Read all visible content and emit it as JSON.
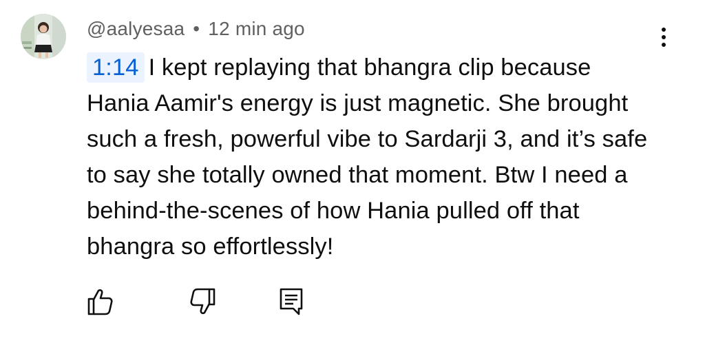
{
  "comment": {
    "author": "@aalyesaa",
    "separator": "•",
    "time_ago": "12 min ago",
    "timestamp_link": "1:14",
    "text": "I kept replaying that bhangra clip because Hania Aamir's energy is just magnetic. She brought such a fresh, powerful vibe to Sardarji 3, and it’s safe to say she totally owned that moment. Btw I need a behind-the-scenes of how Hania pulled off that bhangra so effortlessly!",
    "colors": {
      "text": "#0f0f0f",
      "meta": "#606060",
      "link": "#065fd4",
      "link_bg": "#eaf3ff"
    }
  },
  "icons": {
    "more": "kebab-menu-icon",
    "like": "thumbs-up-icon",
    "dislike": "thumbs-down-icon",
    "reply": "reply-comment-icon"
  }
}
